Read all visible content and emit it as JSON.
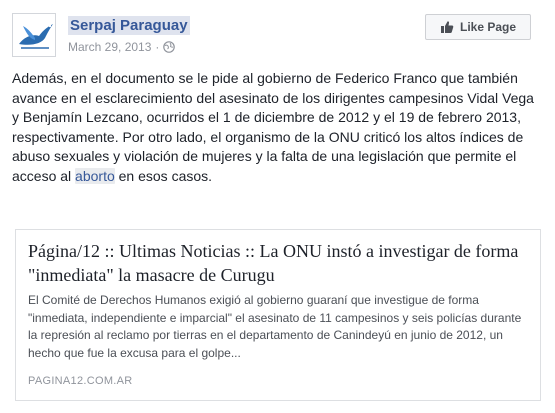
{
  "post": {
    "page_name": "Serpaj Paraguay",
    "date": "March 29, 2013",
    "separator": "·",
    "like_button_label": "Like Page",
    "body_before_link": "Además, en el documento se le pide al gobierno de Federico Franco que también avance en el esclarecimiento del asesinato de los dirigentes campesinos Vidal Vega y Benjamín Lezcano, ocurridos el 1 de diciembre de 2012 y el 19 de febrero 2013, respectivamente. Por otro lado, el organismo de la ONU criticó los altos índices de abuso sexuales y violación de mujeres y la falta de una legislación que permite el acceso al ",
    "body_link": "aborto",
    "body_after_link": " en esos casos."
  },
  "link_card": {
    "title": "Página/12 :: Ultimas Noticias :: La ONU instó a investigar de forma \"inmediata\" la masacre de Curugu",
    "description": "El Comité de Derechos Humanos exigió al gobierno guaraní que investigue de forma \"inmediata, independiente e imparcial\" el asesinato de 11 campesinos y seis policías durante la represión al reclamo por tierras en el departamento de Canindeyú en junio de 2012, un hecho que fue la excusa para el golpe...",
    "domain": "PAGINA12.COM.AR"
  },
  "icons": {
    "avatar": "dove-logo",
    "privacy": "globe-icon",
    "like": "thumbs-up-icon"
  },
  "colors": {
    "link": "#365899",
    "meta": "#90949c",
    "text": "#1d2129",
    "border": "#dddfe2"
  }
}
